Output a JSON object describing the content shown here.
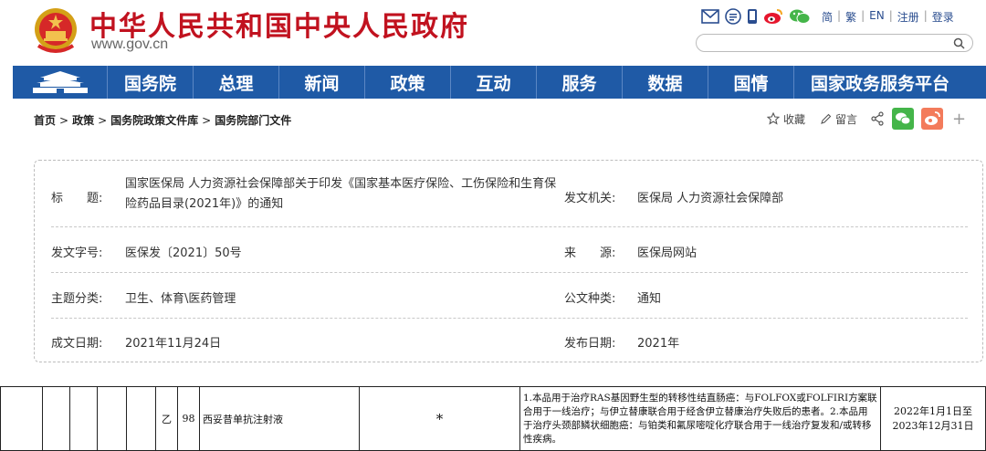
{
  "header": {
    "title": "中华人民共和国中央人民政府",
    "url": "www.gov.cn",
    "icons": [
      "mail-icon",
      "rss-icon",
      "mobile-icon",
      "weibo-icon",
      "wechat-icon"
    ],
    "links": [
      "简",
      "繁",
      "EN",
      "注册",
      "登录"
    ],
    "search_placeholder": ""
  },
  "nav": {
    "home_icon": "tiananmen-icon",
    "items": [
      "国务院",
      "总理",
      "新闻",
      "政策",
      "互动",
      "服务",
      "数据",
      "国情",
      "国家政务服务平台"
    ]
  },
  "breadcrumb": {
    "items": [
      "首页",
      "政策",
      "国务院政策文件库",
      "国务院部门文件"
    ],
    "separator": ">"
  },
  "tools": {
    "favorite": "收藏",
    "comment": "留言"
  },
  "info": {
    "title_label": "标　　题:",
    "title_value": "国家医保局 人力资源社会保障部关于印发《国家基本医疗保险、工伤保险和生育保险药品目录(2021年)》的通知",
    "issuer_label": "发文机关:",
    "issuer_value": "医保局 人力资源社会保障部",
    "doc_no_label": "发文字号:",
    "doc_no_value": "医保发〔2021〕50号",
    "source_label": "来　　源:",
    "source_value": "医保局网站",
    "topic_label": "主题分类:",
    "topic_value": "卫生、体育\\医药管理",
    "type_label": "公文种类:",
    "type_value": "通知",
    "written_label": "成文日期:",
    "written_value": "2021年11月24日",
    "published_label": "发布日期:",
    "published_value": "2021年"
  },
  "table": {
    "row": {
      "category": "乙",
      "number": "98",
      "drug": "西妥昔单抗注射液",
      "mark": "*",
      "note": "1.本品用于治疗RAS基因野生型的转移性结直肠癌：与FOLFOX或FOLFIRI方案联合用于一线治疗；与伊立替康联合用于经含伊立替康治疗失败后的患者。2.本品用于治疗头颈部鳞状细胞癌：与铂类和氟尿嘧啶化疗联合用于一线治疗复发和/或转移性疾病。",
      "period": "2022年1月1日至2023年12月31日"
    }
  },
  "colors": {
    "brand_red": "#c1121f",
    "nav_blue": "#1f5aa6",
    "link_blue": "#2a4d8f"
  }
}
